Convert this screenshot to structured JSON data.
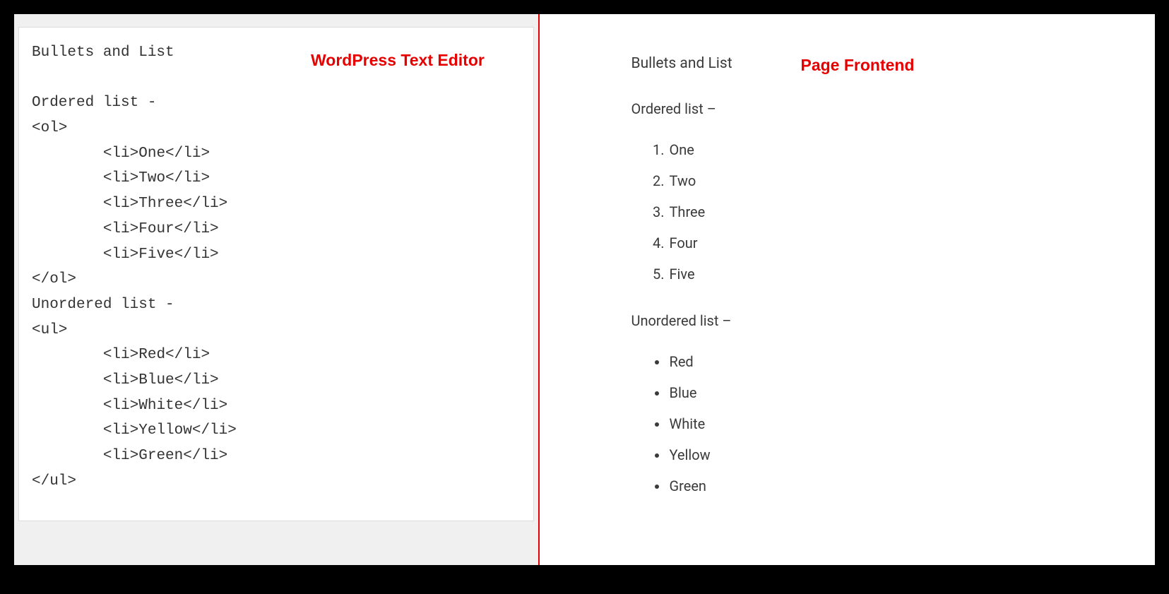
{
  "labels": {
    "editor": "WordPress Text Editor",
    "frontend": "Page Frontend"
  },
  "editor": {
    "title": "Bullets and List",
    "ordered_heading": "Ordered list -",
    "ol_open": "<ol>",
    "ol_close": "</ol>",
    "ol_items": [
      "<li>One</li>",
      "<li>Two</li>",
      "<li>Three</li>",
      "<li>Four</li>",
      "<li>Five</li>"
    ],
    "unordered_heading": "Unordered list -",
    "ul_open": "<ul>",
    "ul_close": "</ul>",
    "ul_items": [
      "<li>Red</li>",
      "<li>Blue</li>",
      "<li>White</li>",
      "<li>Yellow</li>",
      "<li>Green</li>"
    ]
  },
  "frontend": {
    "title": "Bullets and List",
    "ordered_heading": "Ordered list –",
    "unordered_heading": "Unordered list –",
    "ordered_items": [
      "One",
      "Two",
      "Three",
      "Four",
      "Five"
    ],
    "unordered_items": [
      "Red",
      "Blue",
      "White",
      "Yellow",
      "Green"
    ]
  }
}
